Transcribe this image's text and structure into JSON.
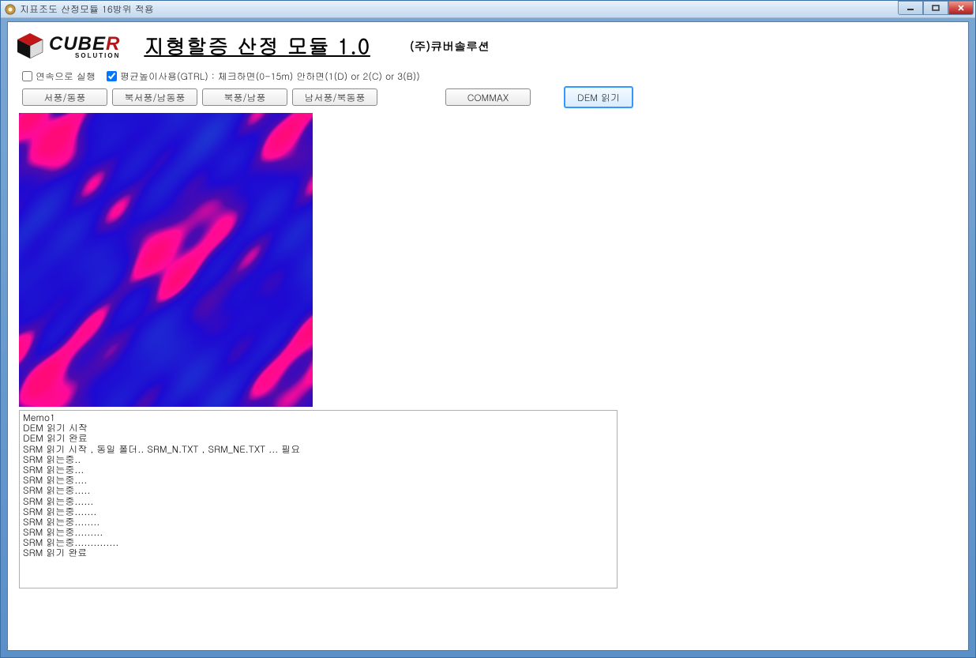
{
  "window": {
    "title": "지표조도 산정모듈 16방위 적용"
  },
  "header": {
    "logo_text_main": "CUBE",
    "logo_text_accent": "R",
    "logo_subtext": "SOLUTION",
    "app_title": "지형할증 산정 모듈 1.0",
    "company": "(주)큐버솔루션"
  },
  "controls": {
    "chk_continuous_label": "연속으로 실행",
    "chk_continuous_checked": false,
    "chk_avgheight_label": "평균높이사용(GTRL) : 체크하면(0-15m) 안하면(1(D) or 2(C) or 3(B))",
    "chk_avgheight_checked": true
  },
  "buttons": {
    "west_east": "서풍/동풍",
    "nw_se": "북서풍/남동풍",
    "north_south": "북풍/남풍",
    "sw_ne": "남서풍/북동풍",
    "commax": "COMMAX",
    "dem_read": "DEM 읽기"
  },
  "memo_lines": [
    "Memo1",
    "DEM 읽기 시작",
    "DEM 읽기 완료",
    "SRM 읽기 시작 , 동일 폴더.. SRM_N.TXT , SRM_NE.TXT ... 필요",
    "SRM 읽는중..",
    "SRM 읽는중...",
    "SRM 읽는중....",
    "SRM 읽는중.....",
    "SRM 읽는중......",
    "SRM 읽는중.......",
    "SRM 읽는중........",
    "SRM 읽는중.........",
    "SRM 읽는중..............",
    "SRM 읽기 완료"
  ]
}
